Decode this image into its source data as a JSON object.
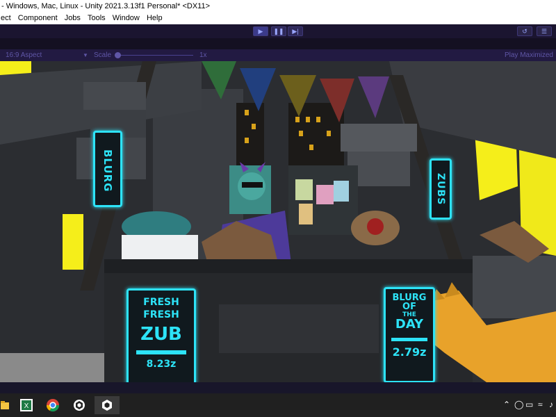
{
  "titlebar": {
    "title": "- Windows, Mac, Linux - Unity 2021.3.13f1 Personal* <DX11>"
  },
  "menubar": {
    "items": [
      "ect",
      "Component",
      "Jobs",
      "Tools",
      "Window",
      "Help"
    ]
  },
  "toolbar": {
    "play_icon": "play-icon",
    "pause_icon": "pause-icon",
    "step_icon": "step-icon",
    "accent": "#3b3a8a"
  },
  "gameview": {
    "aspect": "16:9 Aspect",
    "scale_label": "Scale",
    "scale_value": "1x",
    "play_maximized": "Play Maximized"
  },
  "scene": {
    "sign_left": "BLURG",
    "sign_right": "ZUBS",
    "board_left": {
      "line1": "FRESH",
      "line2": "FRESH",
      "line3": "ZUB",
      "price": "8.23z"
    },
    "board_right": {
      "line1": "BLURG",
      "line2": "OF",
      "line3": "THE",
      "line4": "DAY",
      "price": "2.79z"
    },
    "neon_color": "#2de3f7",
    "window_color": "#f5ee1a"
  },
  "taskbar": {
    "apps": [
      "file-explorer-icon",
      "excel-icon",
      "chrome-icon",
      "unity-hub-icon",
      "unity-icon"
    ]
  }
}
